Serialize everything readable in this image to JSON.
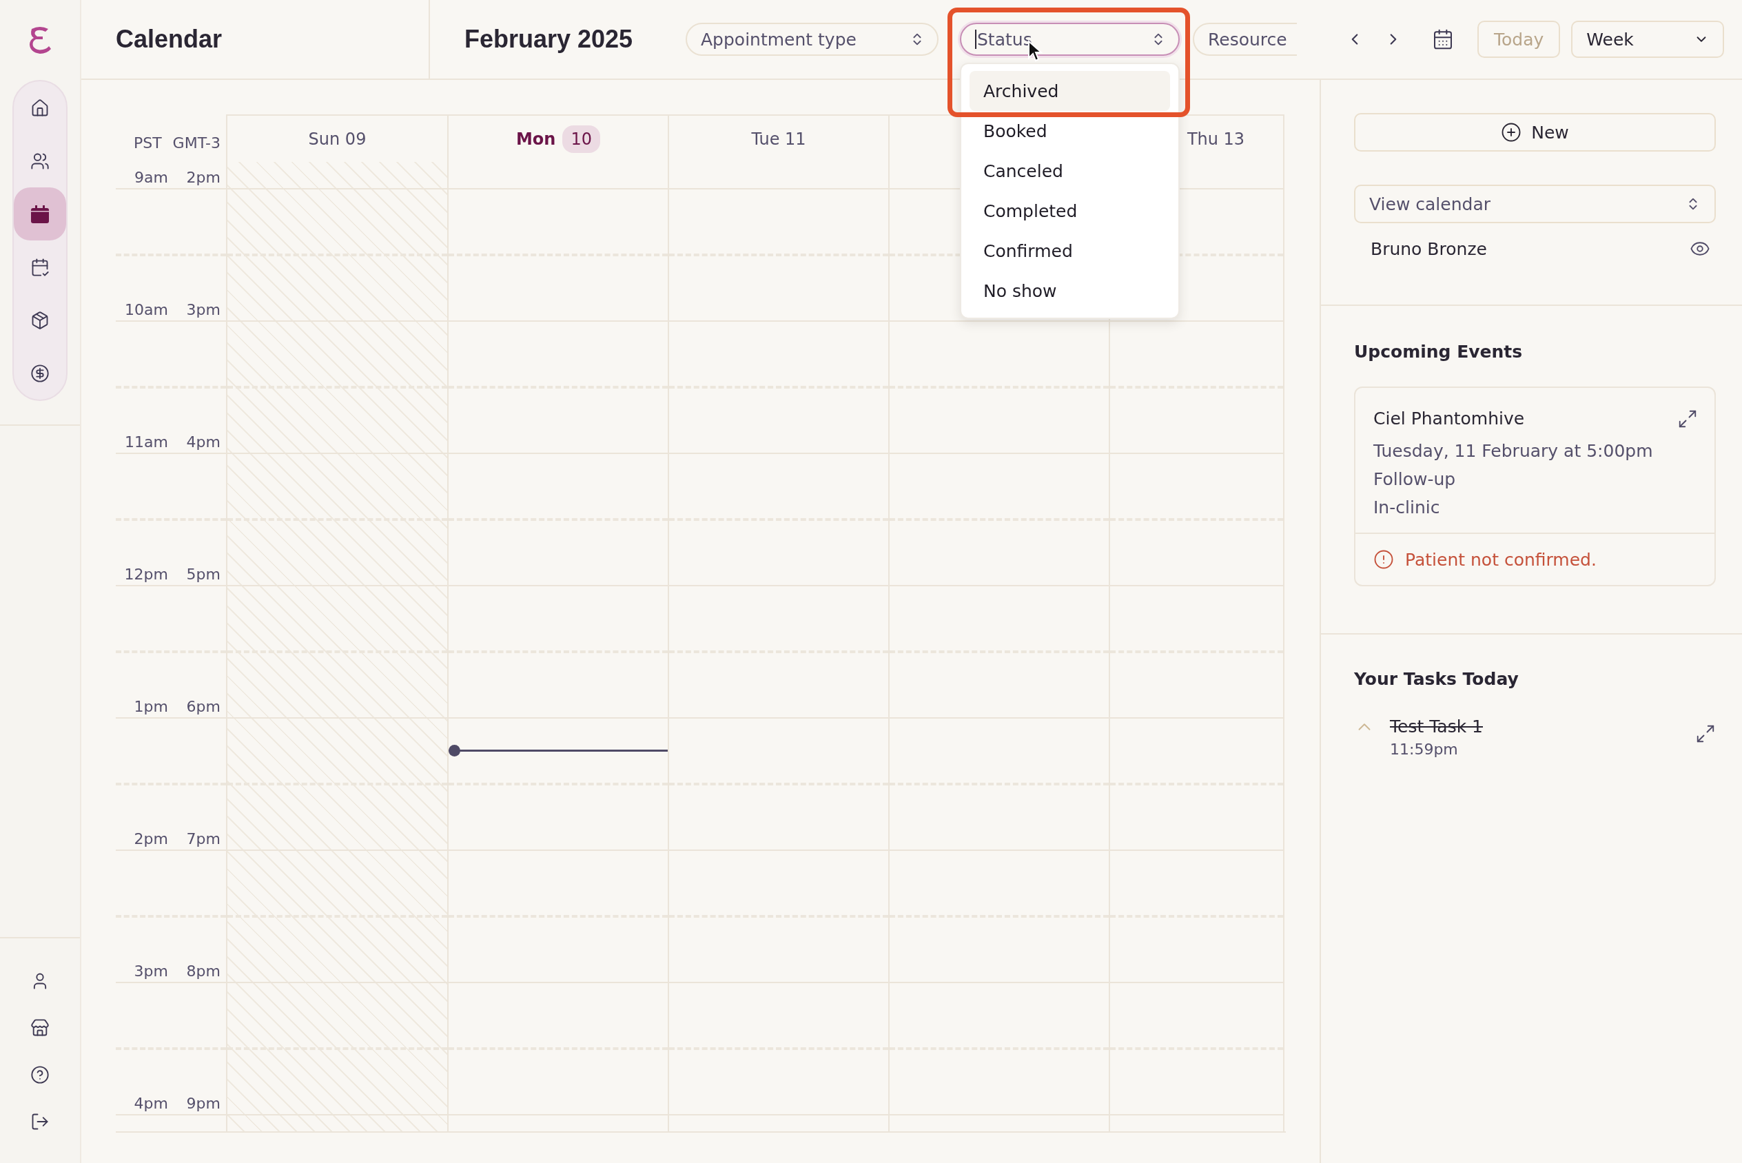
{
  "sidebar": {
    "nav": [
      {
        "selected": false
      },
      {
        "selected": false
      },
      {
        "selected": true
      },
      {
        "selected": false
      },
      {
        "selected": false
      },
      {
        "selected": false
      }
    ]
  },
  "header": {
    "title": "Calendar",
    "month": "February 2025",
    "filters": [
      {
        "placeholder": "Appointment type",
        "open": false
      },
      {
        "placeholder": "Status",
        "open": true,
        "options": [
          {
            "label": "Archived",
            "highlighted": true
          },
          {
            "label": "Booked",
            "highlighted": false
          },
          {
            "label": "Canceled",
            "highlighted": false
          },
          {
            "label": "Completed",
            "highlighted": false
          },
          {
            "label": "Confirmed",
            "highlighted": false
          },
          {
            "label": "No show",
            "highlighted": false
          }
        ]
      },
      {
        "placeholder": "Resource",
        "open": false
      }
    ],
    "today_button": {
      "label": "Today",
      "disabled": true
    },
    "view_select": "Week"
  },
  "calendar": {
    "timezones": [
      "PST",
      "GMT-3"
    ],
    "days": [
      {
        "weekday": "Sun",
        "date": "09",
        "disabled": true,
        "today": false
      },
      {
        "weekday": "Mon",
        "date": "10",
        "disabled": false,
        "today": true
      },
      {
        "weekday": "Tue",
        "date": "11",
        "disabled": false,
        "today": false
      },
      {
        "disabled": false
      },
      {
        "weekday": "Thu",
        "date": "13",
        "disabled": false,
        "today": false
      }
    ],
    "hours": [
      {
        "pst": "9am",
        "local": "2pm"
      },
      {
        "pst": "10am",
        "local": "3pm"
      },
      {
        "pst": "11am",
        "local": "4pm"
      },
      {
        "pst": "12pm",
        "local": "5pm"
      },
      {
        "pst": "1pm",
        "local": "6pm"
      },
      {
        "pst": "2pm",
        "local": "7pm"
      },
      {
        "pst": "3pm",
        "local": "8pm"
      },
      {
        "pst": "4pm",
        "local": "9pm"
      }
    ]
  },
  "right_panel": {
    "new_button": "New",
    "calendar_select": {
      "placeholder": "View calendar"
    },
    "calendars": [
      {
        "name": "Bruno Bronze",
        "visible": true
      }
    ],
    "upcoming": {
      "title": "Upcoming Events",
      "events": [
        {
          "name": "Ciel Phantomhive",
          "when": "Tuesday, 11 February at 5:00pm",
          "type": "Follow-up",
          "location": "In-clinic",
          "warning": "Patient not confirmed."
        }
      ]
    },
    "tasks": {
      "title": "Your Tasks Today",
      "items": [
        {
          "title": "Test Task 1",
          "time": "11:59pm",
          "done": true
        }
      ]
    }
  }
}
